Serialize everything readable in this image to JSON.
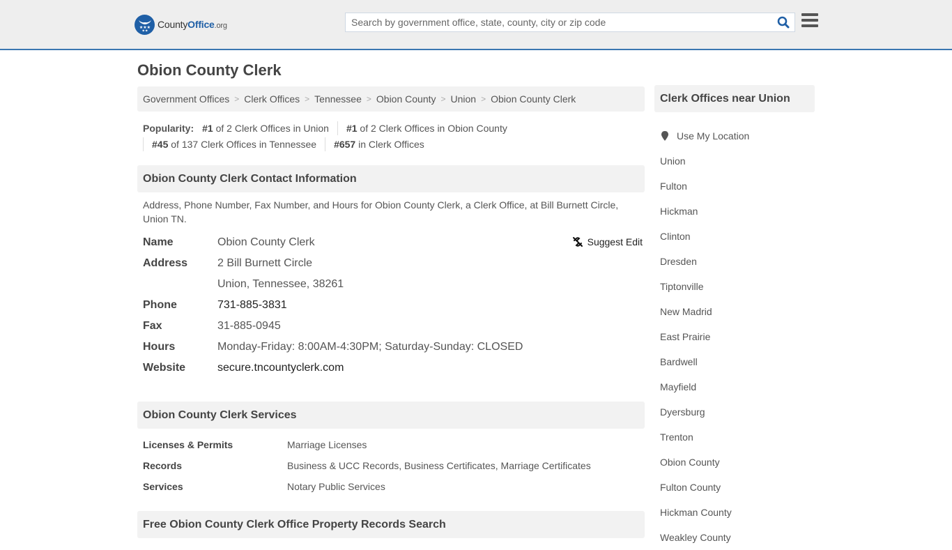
{
  "header": {
    "logo_text_county": "County",
    "logo_text_office": "Office",
    "logo_text_org": ".org",
    "search_placeholder": "Search by government office, state, county, city or zip code",
    "search_value": "",
    "colors": {
      "brand": "#1f5fa6",
      "header_bg": "#eeeeee",
      "header_border": "#3a76b0"
    }
  },
  "page": {
    "title": "Obion County Clerk"
  },
  "breadcrumb": [
    "Government Offices",
    "Clerk Offices",
    "Tennessee",
    "Obion County",
    "Union",
    "Obion County Clerk"
  ],
  "popularity": {
    "label": "Popularity:",
    "items": [
      {
        "rank": "#1",
        "text": " of 2 Clerk Offices in Union"
      },
      {
        "rank": "#1",
        "text": " of 2 Clerk Offices in Obion County"
      },
      {
        "rank": "#45",
        "text": " of 137 Clerk Offices in Tennessee"
      },
      {
        "rank": "#657",
        "text": " in Clerk Offices"
      }
    ]
  },
  "contact_section": {
    "heading": "Obion County Clerk Contact Information",
    "description": "Address, Phone Number, Fax Number, and Hours for Obion County Clerk, a Clerk Office, at Bill Burnett Circle, Union TN.",
    "suggest_edit": "Suggest Edit",
    "fields": {
      "name_label": "Name",
      "name_value": "Obion County Clerk",
      "address_label": "Address",
      "address_line1": "2 Bill Burnett Circle",
      "address_line2": "Union, Tennessee, 38261",
      "phone_label": "Phone",
      "phone_value": "731-885-3831",
      "fax_label": "Fax",
      "fax_value": "31-885-0945",
      "hours_label": "Hours",
      "hours_value": "Monday-Friday: 8:00AM-4:30PM; Saturday-Sunday: CLOSED",
      "website_label": "Website",
      "website_value": "secure.tncountyclerk.com"
    }
  },
  "services_section": {
    "heading": "Obion County Clerk Services",
    "rows": [
      {
        "label": "Licenses & Permits",
        "value": "Marriage Licenses"
      },
      {
        "label": "Records",
        "value": "Business & UCC Records, Business Certificates, Marriage Certificates"
      },
      {
        "label": "Services",
        "value": "Notary Public Services"
      }
    ]
  },
  "property_section": {
    "heading": "Free Obion County Clerk Office Property Records Search"
  },
  "sidebar": {
    "heading": "Clerk Offices near Union",
    "use_location": "Use My Location",
    "links": [
      "Union",
      "Fulton",
      "Hickman",
      "Clinton",
      "Dresden",
      "Tiptonville",
      "New Madrid",
      "East Prairie",
      "Bardwell",
      "Mayfield",
      "Dyersburg",
      "Trenton",
      "Obion County",
      "Fulton County",
      "Hickman County",
      "Weakley County"
    ]
  }
}
